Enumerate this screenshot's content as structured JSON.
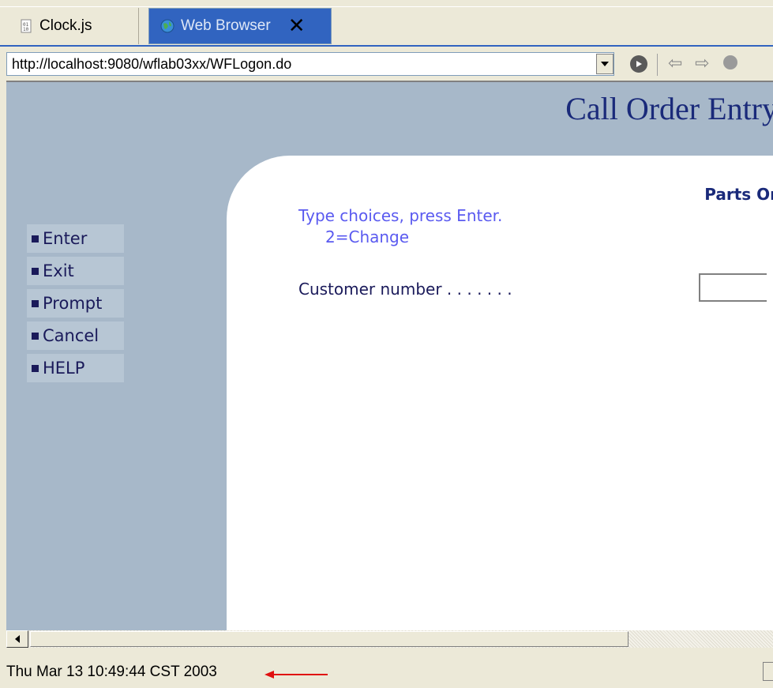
{
  "tabs": [
    {
      "label": "Clock.js",
      "icon": "js-file-icon",
      "active": false
    },
    {
      "label": "Web Browser",
      "icon": "globe-icon",
      "active": true,
      "close_symbol": "✕"
    }
  ],
  "address_bar": {
    "url": "http://localhost:9080/wflab03xx/WFLogon.do"
  },
  "page": {
    "title": "Call Order Entry",
    "subtitle": "Parts Or",
    "instructions": "Type choices, press Enter.",
    "instructions_option": "2=Change",
    "field_label": "Customer number . . . . . . .",
    "field_value": ""
  },
  "nav": {
    "items": [
      {
        "label": "Enter"
      },
      {
        "label": "Exit"
      },
      {
        "label": "Prompt"
      },
      {
        "label": "Cancel"
      },
      {
        "label": "HELP"
      }
    ]
  },
  "status": {
    "clock": "Thu Mar 13 10:49:44 CST 2003"
  },
  "colors": {
    "accent_arrow": "#e01010",
    "sidebar_bg": "#a7b8c9",
    "title_color": "#1a2a7a",
    "instruction_color": "#5a5af0",
    "tab_active_bg": "#3164c0"
  }
}
